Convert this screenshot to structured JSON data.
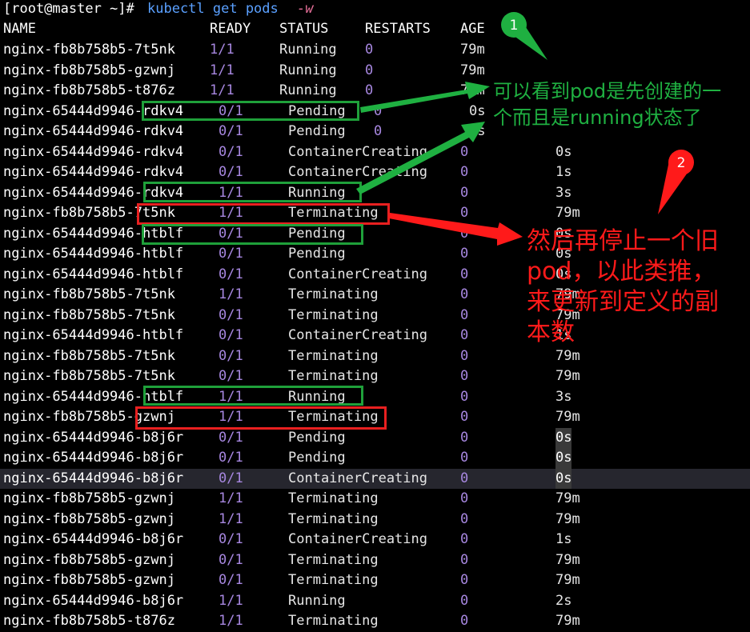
{
  "prompt": {
    "user_host": "[root@master ~]#",
    "command": "kubectl get pods",
    "flag": "-w"
  },
  "headers": {
    "name": "NAME",
    "ready": "READY",
    "status": "STATUS",
    "restarts": "RESTARTS",
    "age": "AGE"
  },
  "rows": [
    {
      "name": "nginx-fb8b758b5-7t5nk",
      "ready": "1/1",
      "status": "Running",
      "restarts": "0",
      "age": "79m"
    },
    {
      "name": "nginx-fb8b758b5-gzwnj",
      "ready": "1/1",
      "status": "Running",
      "restarts": "0",
      "age": "79m"
    },
    {
      "name": "nginx-fb8b758b5-t876z",
      "ready": "1/1",
      "status": "Running",
      "restarts": "0",
      "age": "79m"
    },
    {
      "name": "nginx-65444d9946-rdkv4",
      "ready": "0/1",
      "status": "Pending",
      "restarts": "0",
      "age": "0s"
    },
    {
      "name": "nginx-65444d9946-rdkv4",
      "ready": "0/1",
      "status": "Pending",
      "restarts": "0",
      "age": "0s"
    },
    {
      "name": "nginx-65444d9946-rdkv4",
      "ready": "0/1",
      "status": "ContainerCreating",
      "restarts": "0",
      "age": "0s"
    },
    {
      "name": "nginx-65444d9946-rdkv4",
      "ready": "0/1",
      "status": "ContainerCreating",
      "restarts": "0",
      "age": "1s"
    },
    {
      "name": "nginx-65444d9946-rdkv4",
      "ready": "1/1",
      "status": "Running",
      "restarts": "0",
      "age": "3s"
    },
    {
      "name": "nginx-fb8b758b5-7t5nk",
      "ready": "1/1",
      "status": "Terminating",
      "restarts": "0",
      "age": "79m"
    },
    {
      "name": "nginx-65444d9946-htblf",
      "ready": "0/1",
      "status": "Pending",
      "restarts": "0",
      "age": "0s"
    },
    {
      "name": "nginx-65444d9946-htblf",
      "ready": "0/1",
      "status": "Pending",
      "restarts": "0",
      "age": "0s"
    },
    {
      "name": "nginx-65444d9946-htblf",
      "ready": "0/1",
      "status": "ContainerCreating",
      "restarts": "0",
      "age": "0s"
    },
    {
      "name": "nginx-fb8b758b5-7t5nk",
      "ready": "1/1",
      "status": "Terminating",
      "restarts": "0",
      "age": "79m"
    },
    {
      "name": "nginx-fb8b758b5-7t5nk",
      "ready": "0/1",
      "status": "Terminating",
      "restarts": "0",
      "age": "79m"
    },
    {
      "name": "nginx-65444d9946-htblf",
      "ready": "0/1",
      "status": "ContainerCreating",
      "restarts": "0",
      "age": "1s"
    },
    {
      "name": "nginx-fb8b758b5-7t5nk",
      "ready": "0/1",
      "status": "Terminating",
      "restarts": "0",
      "age": "79m"
    },
    {
      "name": "nginx-fb8b758b5-7t5nk",
      "ready": "0/1",
      "status": "Terminating",
      "restarts": "0",
      "age": "79m"
    },
    {
      "name": "nginx-65444d9946-htblf",
      "ready": "1/1",
      "status": "Running",
      "restarts": "0",
      "age": "3s"
    },
    {
      "name": "nginx-fb8b758b5-gzwnj",
      "ready": "1/1",
      "status": "Terminating",
      "restarts": "0",
      "age": "79m"
    },
    {
      "name": "nginx-65444d9946-b8j6r",
      "ready": "0/1",
      "status": "Pending",
      "restarts": "0",
      "age": "0s"
    },
    {
      "name": "nginx-65444d9946-b8j6r",
      "ready": "0/1",
      "status": "Pending",
      "restarts": "0",
      "age": "0s"
    },
    {
      "name": "nginx-65444d9946-b8j6r",
      "ready": "0/1",
      "status": "ContainerCreating",
      "restarts": "0",
      "age": "0s"
    },
    {
      "name": "nginx-fb8b758b5-gzwnj",
      "ready": "1/1",
      "status": "Terminating",
      "restarts": "0",
      "age": "79m"
    },
    {
      "name": "nginx-fb8b758b5-gzwnj",
      "ready": "1/1",
      "status": "Terminating",
      "restarts": "0",
      "age": "79m"
    },
    {
      "name": "nginx-65444d9946-b8j6r",
      "ready": "0/1",
      "status": "ContainerCreating",
      "restarts": "0",
      "age": "1s"
    },
    {
      "name": "nginx-fb8b758b5-gzwnj",
      "ready": "0/1",
      "status": "Terminating",
      "restarts": "0",
      "age": "79m"
    },
    {
      "name": "nginx-fb8b758b5-gzwnj",
      "ready": "0/1",
      "status": "Terminating",
      "restarts": "0",
      "age": "79m"
    },
    {
      "name": "nginx-65444d9946-b8j6r",
      "ready": "1/1",
      "status": "Running",
      "restarts": "0",
      "age": "2s"
    },
    {
      "name": "nginx-fb8b758b5-t876z",
      "ready": "1/1",
      "status": "Terminating",
      "restarts": "0",
      "age": "79m"
    }
  ],
  "annotations": {
    "badge1": "1",
    "badge2": "2",
    "note1": "可以看到pod是先创建的一\n个而且是running状态了",
    "note2": "然后再停止一个旧\npod，以此类推，\n来更新到定义的副\n本数"
  },
  "colors": {
    "background": "#000000",
    "numeric": "#a787e0",
    "command": "#5aa0ff",
    "flag": "#e8709a",
    "annotation_green": "#1fb041",
    "annotation_red": "#ff1a1a"
  }
}
